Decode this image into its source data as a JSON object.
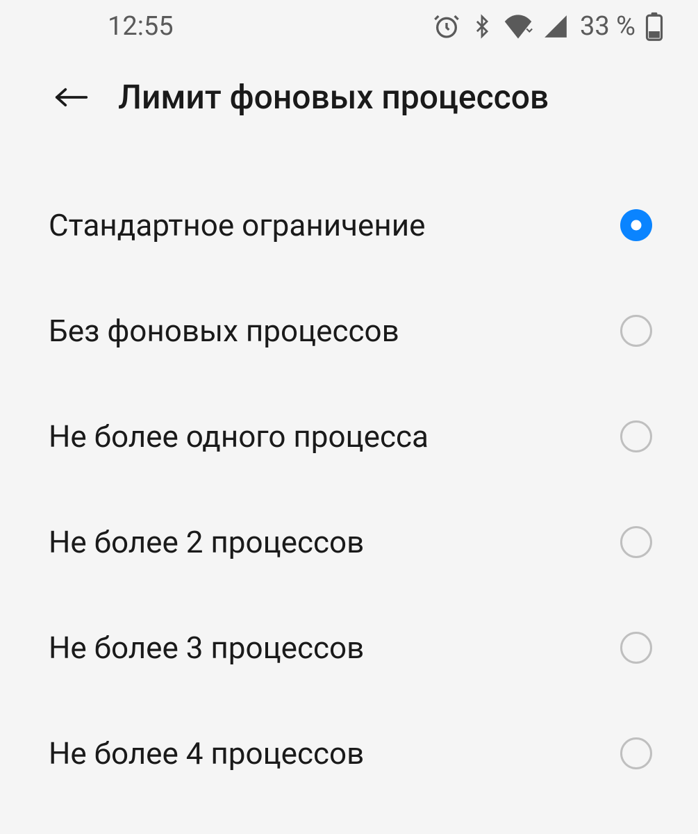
{
  "status_bar": {
    "time": "12:55",
    "battery_percent": "33 %"
  },
  "header": {
    "title": "Лимит фоновых процессов"
  },
  "options": [
    {
      "label": "Стандартное ограничение",
      "selected": true
    },
    {
      "label": "Без фоновых процессов",
      "selected": false
    },
    {
      "label": "Не более одного процесса",
      "selected": false
    },
    {
      "label": "Не более 2 процессов",
      "selected": false
    },
    {
      "label": "Не более 3 процессов",
      "selected": false
    },
    {
      "label": "Не более 4 процессов",
      "selected": false
    }
  ]
}
